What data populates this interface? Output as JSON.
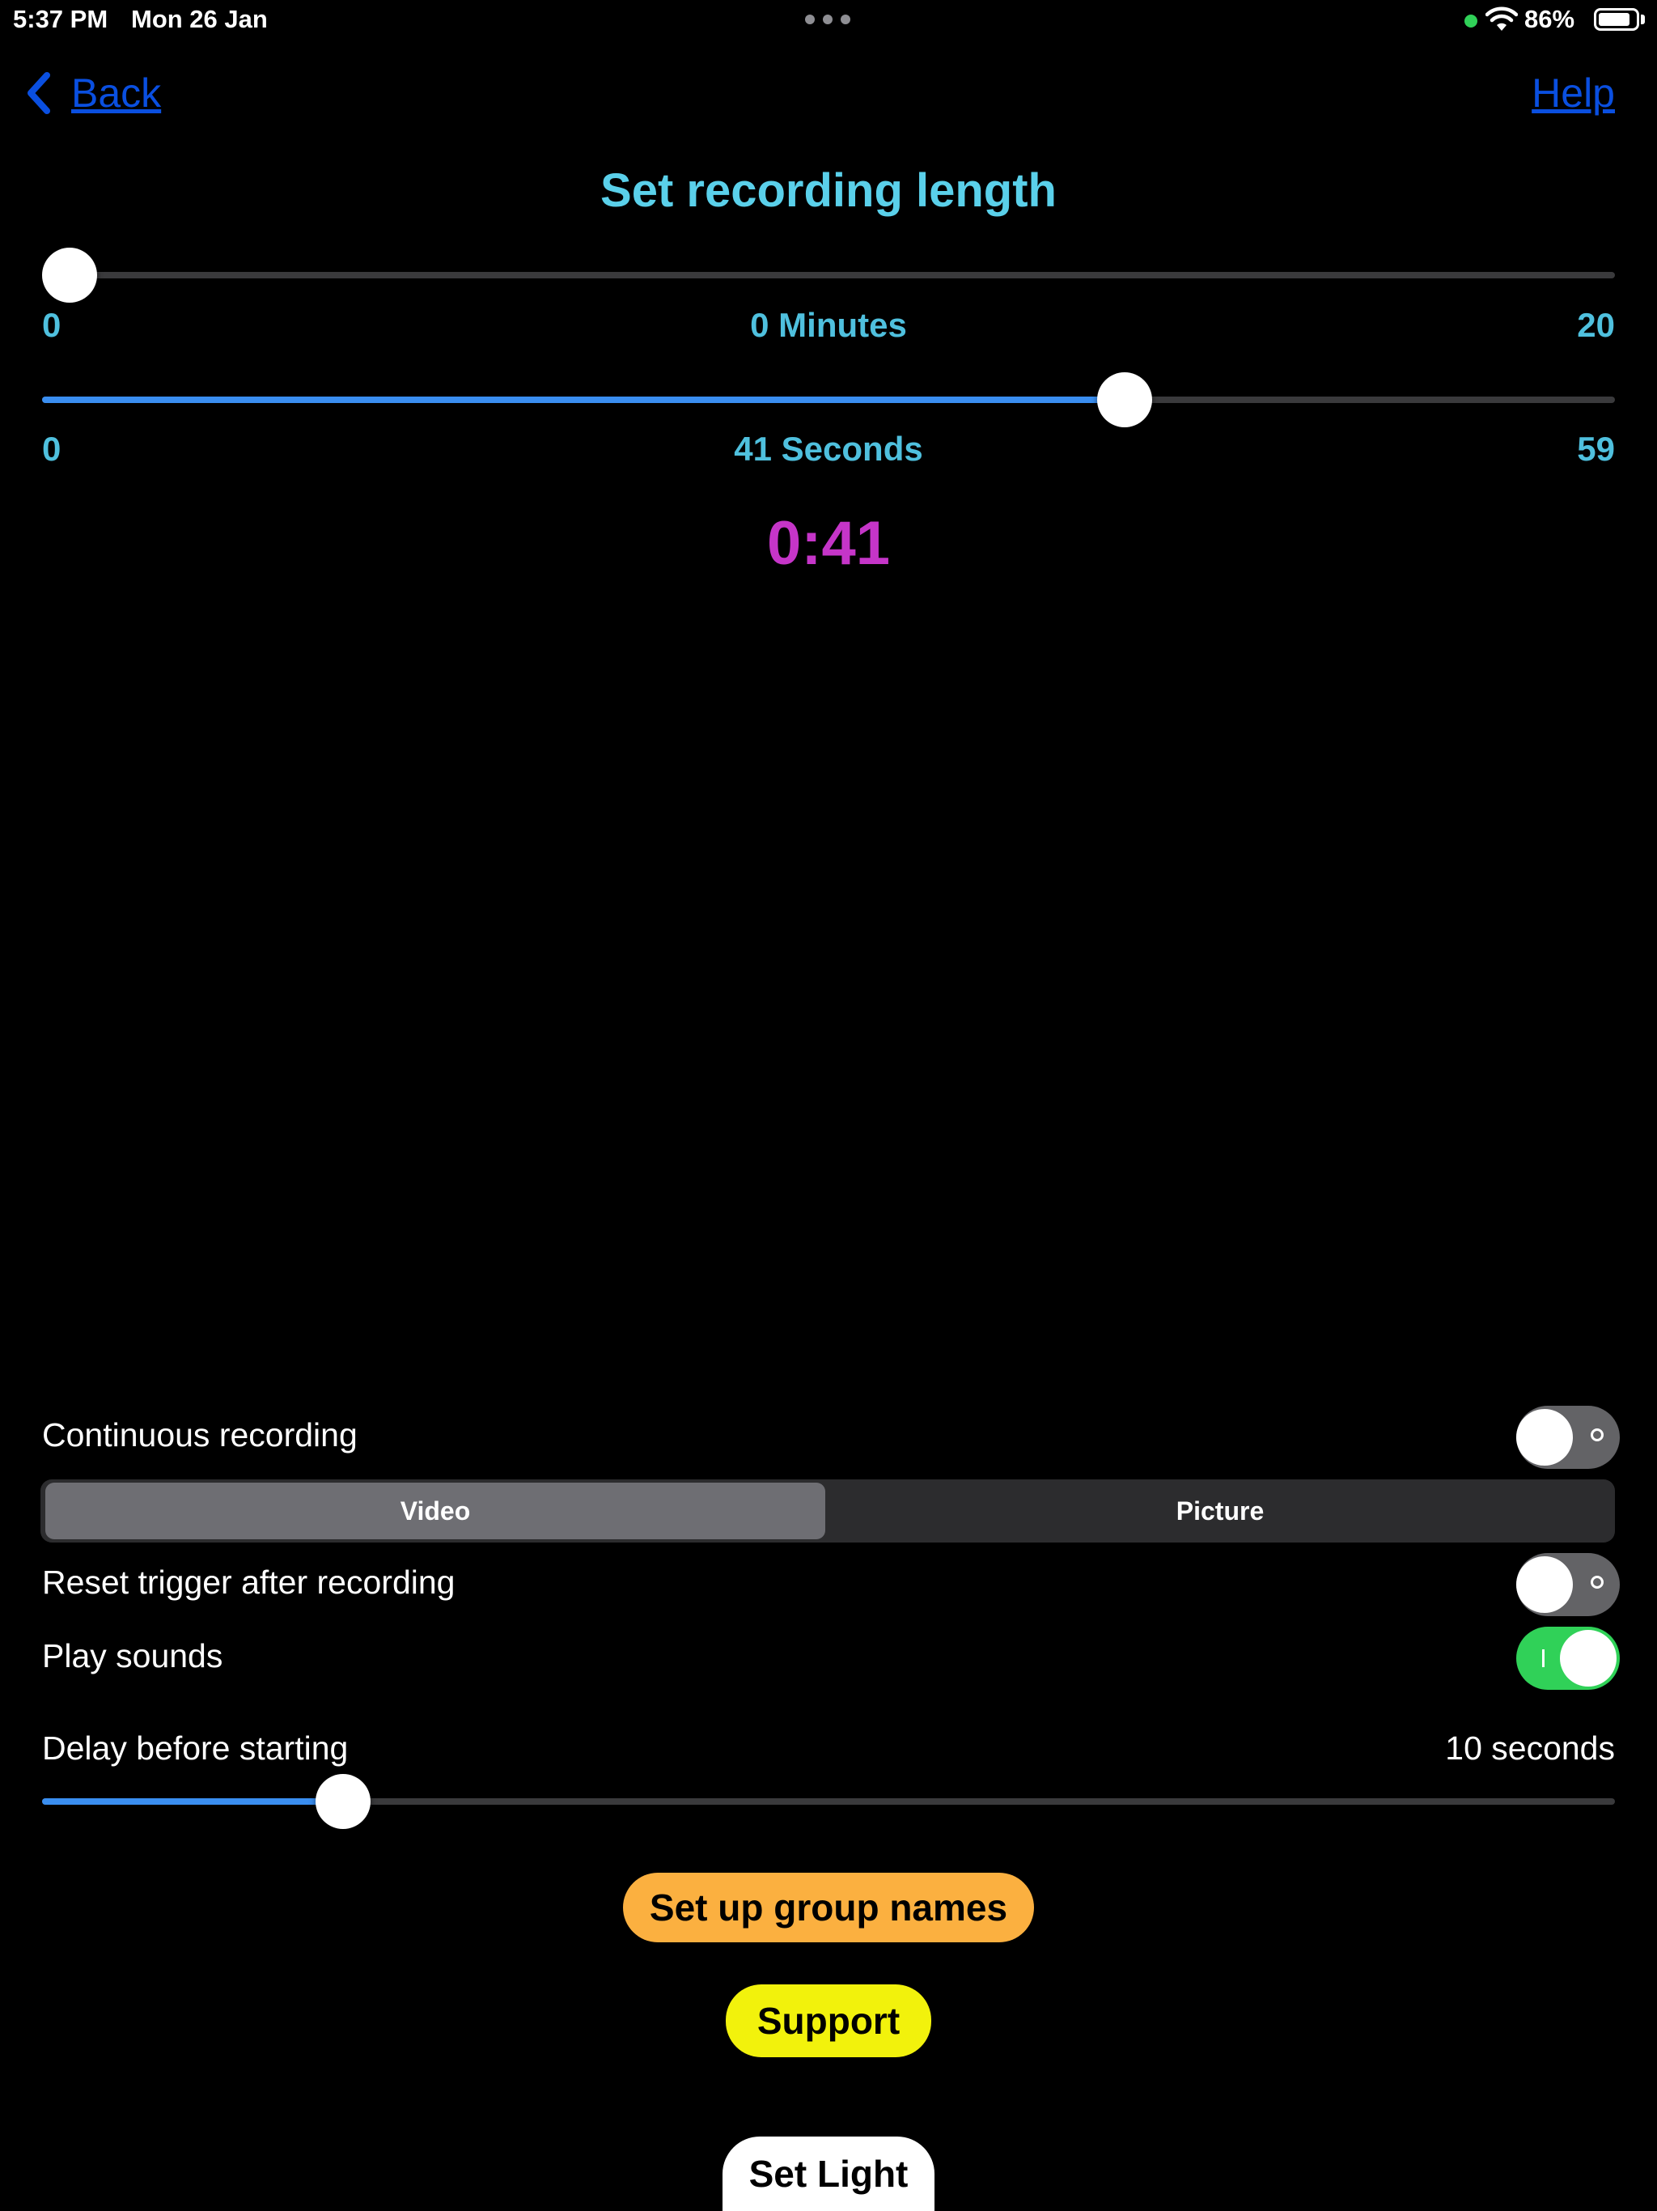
{
  "status_bar": {
    "time": "5:37 PM",
    "date": "Mon 26 Jan",
    "battery_percent": "86%",
    "battery_level": 0.86
  },
  "nav": {
    "back_label": "Back",
    "help_label": "Help"
  },
  "title": "Set recording length",
  "minutes_slider": {
    "min_label": "0",
    "max_label": "20",
    "value_label": "0 Minutes",
    "value": 0,
    "min": 0,
    "max": 20
  },
  "seconds_slider": {
    "min_label": "0",
    "max_label": "59",
    "value_label": "41 Seconds",
    "value": 41,
    "min": 0,
    "max": 59
  },
  "total_time": "0:41",
  "settings": {
    "continuous_recording": {
      "label": "Continuous recording",
      "on": false
    },
    "mode": {
      "options": [
        "Video",
        "Picture"
      ],
      "selected": "Video"
    },
    "reset_trigger": {
      "label": "Reset trigger after recording",
      "on": false
    },
    "play_sounds": {
      "label": "Play sounds",
      "on": true
    },
    "delay": {
      "label": "Delay before starting",
      "value_label": "10 seconds",
      "level": 0.18
    }
  },
  "buttons": {
    "group_names": "Set up group names",
    "support": "Support",
    "set_light": "Set Light"
  },
  "colors": {
    "title": "#5ad0ea",
    "total_time": "#c535c8",
    "link": "#0a4fe0",
    "slider_fill": "#3a8ef0",
    "toggle_on": "#30d158",
    "group_names_button": "#fbb040",
    "support_button": "#f2f20c",
    "set_light_button": "#ffffff"
  }
}
